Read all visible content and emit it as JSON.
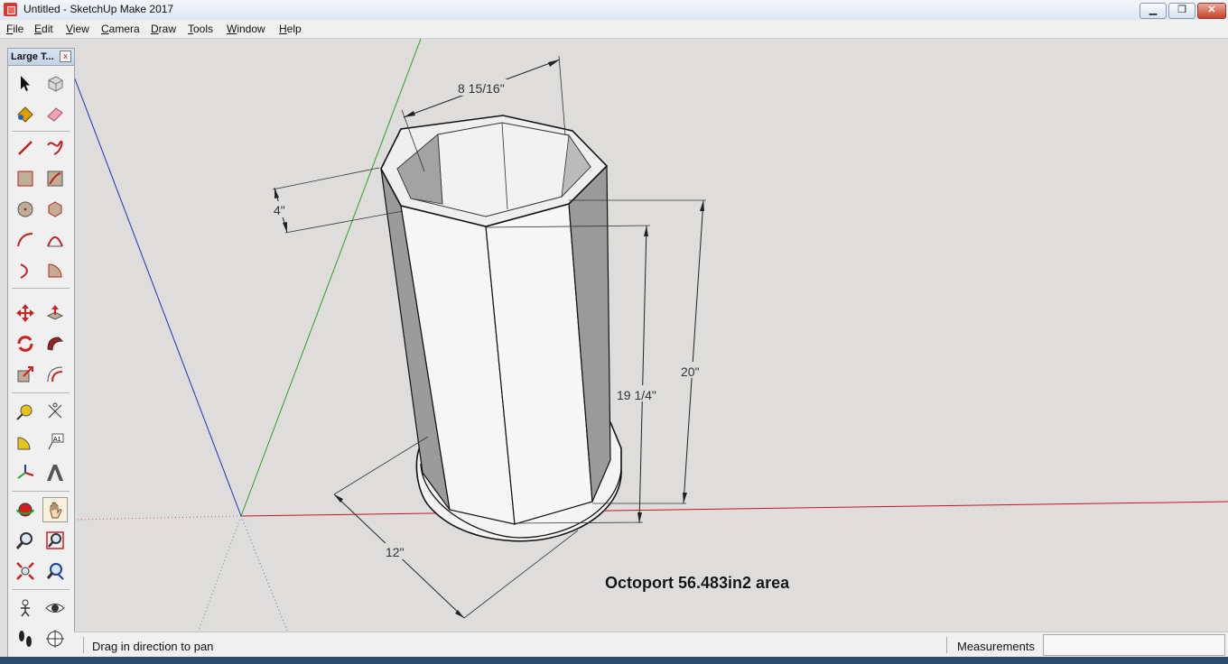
{
  "window": {
    "title": "Untitled - SketchUp Make 2017",
    "minimize_glyph": "▁",
    "maximize_glyph": "❐",
    "close_glyph": "✕"
  },
  "menu": [
    "File",
    "Edit",
    "View",
    "Camera",
    "Draw",
    "Tools",
    "Window",
    "Help"
  ],
  "toolbar": {
    "title": "Large T...",
    "close_glyph": "x",
    "tools": [
      "select-tool-icon",
      "make-component-icon",
      "paint-bucket-icon",
      "eraser-icon",
      "line-icon",
      "freehand-icon",
      "rectangle-icon",
      "rotated-rectangle-icon",
      "circle-icon",
      "polygon-icon",
      "arc-icon",
      "two-point-arc-icon",
      "three-point-arc-icon",
      "pie-icon",
      "move-icon",
      "push-pull-icon",
      "rotate-icon",
      "follow-me-icon",
      "scale-icon",
      "offset-icon",
      "tape-measure-icon",
      "dimension-icon",
      "protractor-icon",
      "text-icon",
      "axes-icon",
      "3d-text-icon",
      "orbit-icon",
      "pan-icon",
      "zoom-icon",
      "zoom-window-icon",
      "zoom-extents-icon",
      "previous-view-icon",
      "position-camera-icon",
      "look-around-icon",
      "walk-icon",
      "section-plane-icon"
    ],
    "active_tool": "pan-icon"
  },
  "model": {
    "dimensions": {
      "top_width": "8 15/16\"",
      "wall": "4\"",
      "base": "12\"",
      "inner_height": "19 1/4\"",
      "outer_height": "20\""
    },
    "label": "Octoport 56.483in2 area"
  },
  "status": {
    "hint": "Drag in direction to pan",
    "measurements_label": "Measurements",
    "measurements_value": ""
  },
  "colors": {
    "x_axis": "#c01818",
    "y_axis": "#2aa12a",
    "z_axis": "#2030c0",
    "background": "#dedddb"
  }
}
